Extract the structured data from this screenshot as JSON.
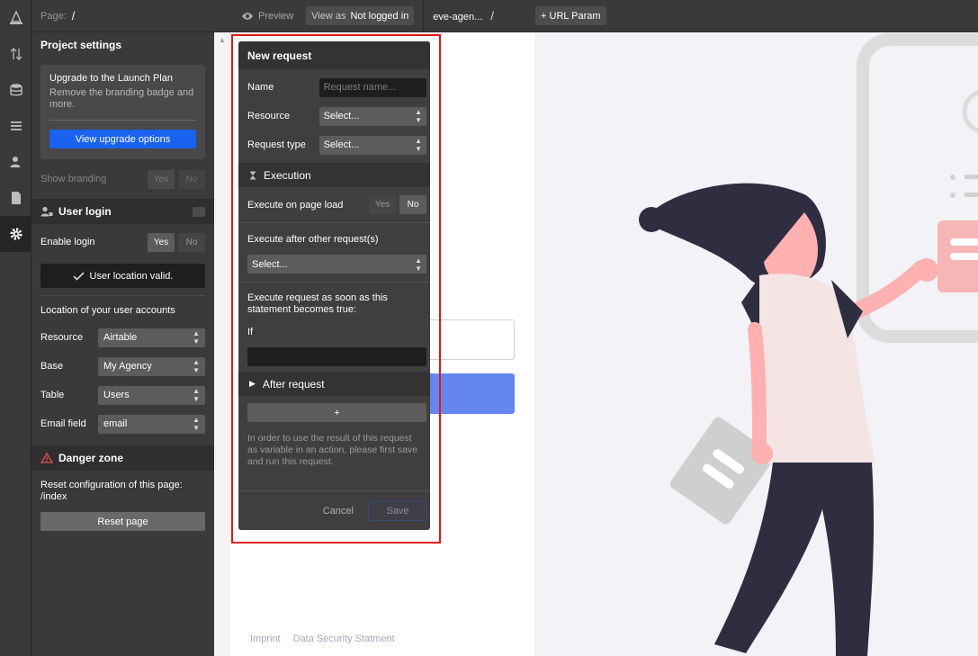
{
  "toolbar": {
    "page_label": "Page:",
    "page_path": "/",
    "preview_label": "Preview",
    "view_as_label": "View as",
    "view_as_value": "Not logged in",
    "project_name": "eve-agen...",
    "project_path": "/",
    "url_param_label": "+ URL Param"
  },
  "rail": {
    "items": [
      "sitemap-icon",
      "sort-arrows-icon",
      "database-icon",
      "list-icon",
      "user-icon",
      "file-icon",
      "gear-icon"
    ],
    "active_index": 6
  },
  "settings": {
    "title": "Project settings",
    "upgrade": {
      "heading": "Upgrade to the Launch Plan",
      "subtitle": "Remove the branding badge and more.",
      "button": "View upgrade options"
    },
    "show_branding": {
      "label": "Show branding",
      "yes": "Yes",
      "no": "No"
    },
    "user_login": {
      "title": "User login",
      "enable_label": "Enable login",
      "yes": "Yes",
      "no": "No",
      "valid_text": "User location valid.",
      "location_heading": "Location of your user accounts",
      "fields": [
        {
          "label": "Resource",
          "value": "Airtable"
        },
        {
          "label": "Base",
          "value": "My Agency"
        },
        {
          "label": "Table",
          "value": "Users"
        },
        {
          "label": "Email field",
          "value": "email"
        }
      ]
    },
    "danger": {
      "title": "Danger zone",
      "reset_text": "Reset configuration of this page: /index",
      "reset_button": "Reset page"
    }
  },
  "modal": {
    "title": "New request",
    "name_label": "Name",
    "name_placeholder": "Request name...",
    "resource_label": "Resource",
    "resource_value": "Select...",
    "type_label": "Request type",
    "type_value": "Select...",
    "execution_title": "Execution",
    "exec_on_load_label": "Execute on page load",
    "exec_yes": "Yes",
    "exec_no": "No",
    "exec_after_label": "Execute after other request(s)",
    "exec_after_value": "Select...",
    "exec_condition_label": "Execute request as soon as this statement becomes true:",
    "if_label": "If",
    "after_request_title": "After request",
    "add_label": "+",
    "note": "In order to use the result of this request as variable in an action, please first save and run this request.",
    "cancel_label": "Cancel",
    "save_label": "Save"
  },
  "page_footer": {
    "links": [
      "Imprint",
      "Data Security Statment"
    ]
  },
  "colors": {
    "accent_blue": "#1a62f0",
    "highlight_red": "#e01818",
    "page_button": "#6486ee"
  }
}
